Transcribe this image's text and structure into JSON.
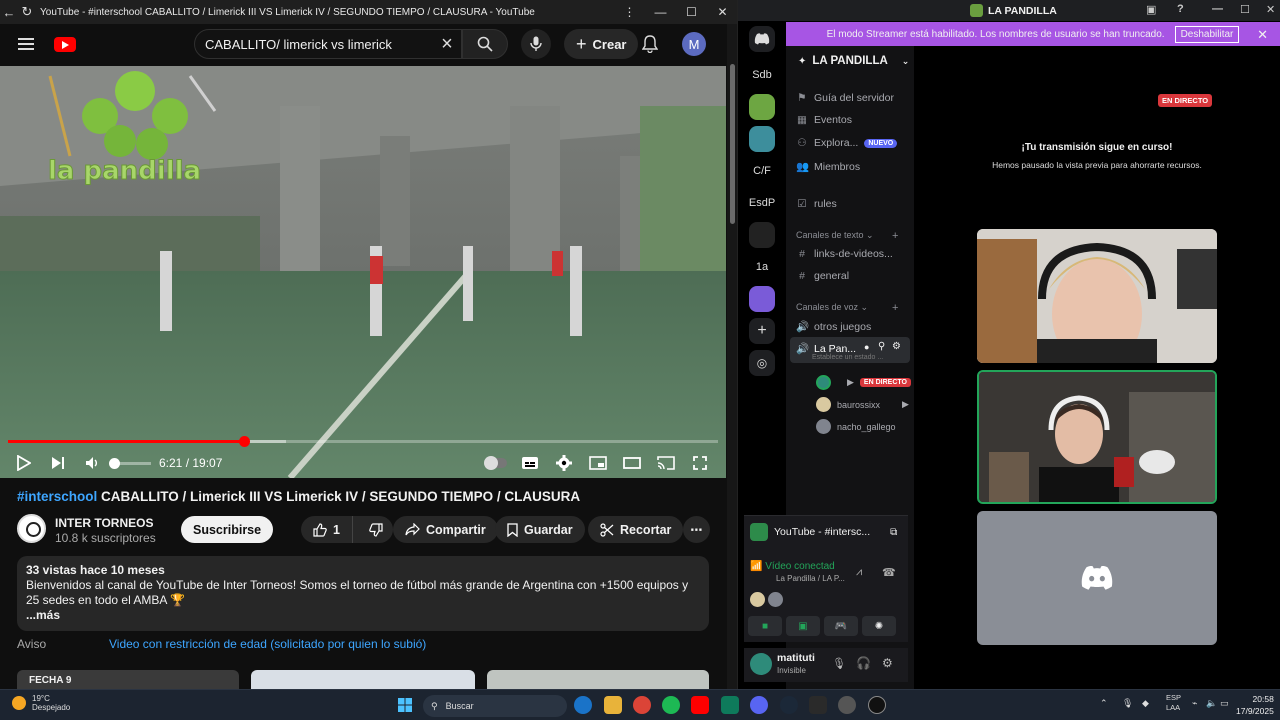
{
  "youtube": {
    "window_title": "YouTube - #interschool CABALLITO / Limerick III VS Limerick IV / SEGUNDO TIEMPO / CLAUSURA - YouTube",
    "search_value": "CABALLITO/ limerick vs limerick",
    "create_label": "Crear",
    "avatar_letter": "M",
    "overlay_logo_text": "la pandilla",
    "player": {
      "time": "6:21 / 19:07",
      "played_fraction": 0.332,
      "loaded_fraction": 0.392
    },
    "video": {
      "title_tag": "#interschool",
      "title_rest": " CABALLITO / Limerick III VS Limerick IV / SEGUNDO TIEMPO / CLAUSURA",
      "channel_name": "INTER TORNEOS",
      "subscribers": "10.8 k suscriptores",
      "subscribe_label": "Suscribirse",
      "like_count": "1",
      "share_label": "Compartir",
      "save_label": "Guardar",
      "clip_label": "Recortar"
    },
    "description": {
      "meta": "33 vistas  hace 10 meses",
      "text": "Bienvenidos al canal de YouTube de Inter Torneos! Somos el torneo de fútbol más grande de Argentina con +1500 equipos y 25 sedes en todo el AMBA 🏆",
      "more": "...más"
    },
    "notice": {
      "label": "Aviso",
      "value": "Video con restricción de edad (solicitado por quien lo subió)"
    },
    "thumbs": [
      "FECHA 9",
      "",
      ""
    ]
  },
  "discord": {
    "window_title": "LA PANDILLA",
    "streamer_banner": "El modo Streamer está habilitado. Los nombres de usuario se han truncado.",
    "disable_label": "Deshabilitar",
    "servers": [
      "Sdb",
      "C/F",
      "EsdP",
      "1a"
    ],
    "guild_name": "LA PANDILLA",
    "nav": [
      {
        "label": "Guía del servidor",
        "icon": "guide-icon"
      },
      {
        "label": "Eventos",
        "icon": "calendar-icon"
      },
      {
        "label": "Explora...",
        "icon": "explore-icon",
        "badge": "NUEVO"
      },
      {
        "label": "Miembros",
        "icon": "members-icon"
      }
    ],
    "rules_channel": "rules",
    "text_category": "Canales de texto",
    "text_channels": [
      "links-de-videos...",
      "general"
    ],
    "voice_category": "Canales de voz",
    "voice_channels": [
      "otros juegos",
      "La Pan..."
    ],
    "voice_status": "Establece un estado ...",
    "live_label": "EN DIRECTO",
    "voice_users": [
      "baurossixx",
      "nacho_gallego"
    ],
    "activity": "YouTube - #intersc...",
    "voice_connected": "Vídeo conectad",
    "voice_location": "La Pandilla / LA P...",
    "username": "matituti",
    "user_status": "Invisible",
    "stream_live": "EN DIRECTO",
    "stream_msg": "¡Tu transmisión sigue en curso!",
    "stream_sub": "Hemos pausado la vista previa para ahorrarte recursos."
  },
  "taskbar": {
    "temp": "19°C",
    "weather": "Despejado",
    "search": "Buscar",
    "lang": "ESP",
    "lang2": "LAA",
    "time": "20:58",
    "date": "17/9/2025"
  },
  "colors": {
    "accent_red": "#ff0000",
    "discord_purple": "#a755e4",
    "link_blue": "#3ea6ff",
    "live_red": "#da373c"
  }
}
